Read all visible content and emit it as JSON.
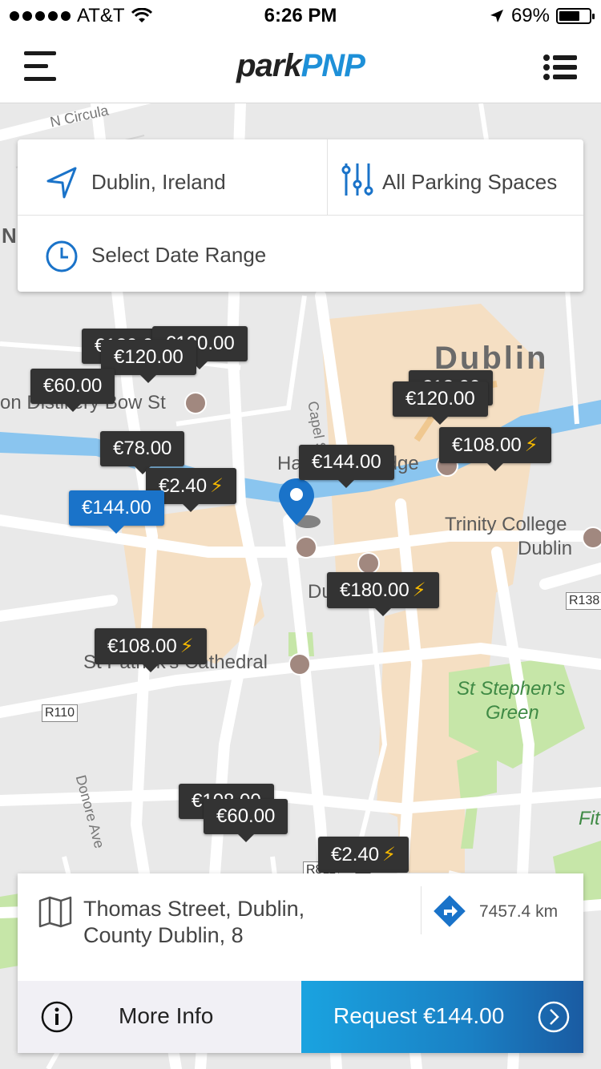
{
  "status_bar": {
    "carrier": "AT&T",
    "time": "6:26 PM",
    "battery": "69%",
    "battery_level": 0.69
  },
  "header": {
    "logo_part1": "park",
    "logo_part2": "PNP",
    "menu_icon": "hamburger-icon",
    "list_icon": "list-icon"
  },
  "search": {
    "location": "Dublin, Ireland",
    "filter": "All Parking Spaces",
    "date": "Select Date Range",
    "location_icon": "navigation-arrow-icon",
    "filter_icon": "sliders-icon",
    "date_icon": "clock-icon"
  },
  "map": {
    "labels": {
      "n_circular": "N Circula",
      "dublin": "Dublin",
      "distillery": "on Distillery Bow St",
      "capel": "Capel St",
      "hapenny": "Ha'penny Bridge",
      "trinity1": "Trinity College",
      "trinity2": "Dublin",
      "dublin_castle": "Dublin Castle",
      "st_patricks": "St Patrick's Cathedral",
      "stephens1": "St Stephen's",
      "stephens2": "Green",
      "donore": "Donore Ave",
      "fit": "Fit",
      "n_letter": "N"
    },
    "shields": {
      "r110": "R110",
      "r138": "R138",
      "r811": "R811"
    }
  },
  "prices": [
    {
      "id": "p1",
      "label": "€120.00",
      "ev": false,
      "active": false
    },
    {
      "id": "p2",
      "label": "€60.00",
      "ev": false,
      "active": false
    },
    {
      "id": "p3",
      "label": "€18.00",
      "ev": false,
      "active": false
    },
    {
      "id": "p4",
      "label": "€120.00",
      "ev": false,
      "active": false
    },
    {
      "id": "p5",
      "label": "€108.00",
      "ev": true,
      "active": false
    },
    {
      "id": "p6",
      "label": "€78.00",
      "ev": false,
      "active": false
    },
    {
      "id": "p7",
      "label": "€144.00",
      "ev": false,
      "active": false
    },
    {
      "id": "p8",
      "label": "€2.40",
      "ev": true,
      "active": false
    },
    {
      "id": "p9",
      "label": "€144.00",
      "ev": false,
      "active": true
    },
    {
      "id": "p10",
      "label": "€180.00",
      "ev": true,
      "active": false
    },
    {
      "id": "p11",
      "label": "€108.00",
      "ev": true,
      "active": false
    },
    {
      "id": "p12",
      "label": "€108.00",
      "ev": false,
      "active": false
    },
    {
      "id": "p13",
      "label": "€60.00",
      "ev": false,
      "active": false
    },
    {
      "id": "p14",
      "label": "€2.40",
      "ev": true,
      "active": false
    },
    {
      "id": "p15",
      "label": "€120.00",
      "ev": false,
      "active": false
    }
  ],
  "ev_glyph": "⚡",
  "selected": {
    "address": "Thomas Street, Dublin, County Dublin, 8",
    "distance": "7457.4 km",
    "more_info": "More Info",
    "request": "Request €144.00",
    "map_icon": "map-icon",
    "directions_icon": "directions-icon",
    "info_icon": "info-icon",
    "arrow_icon": "chevron-right-circle-icon"
  },
  "colors": {
    "brand_blue": "#1e90d8",
    "marker_dark": "#333333",
    "marker_active": "#1a73c9",
    "ev_yellow": "#f5b800",
    "request_gradient_start": "#1aa3e0",
    "request_gradient_end": "#1a5ba2"
  }
}
